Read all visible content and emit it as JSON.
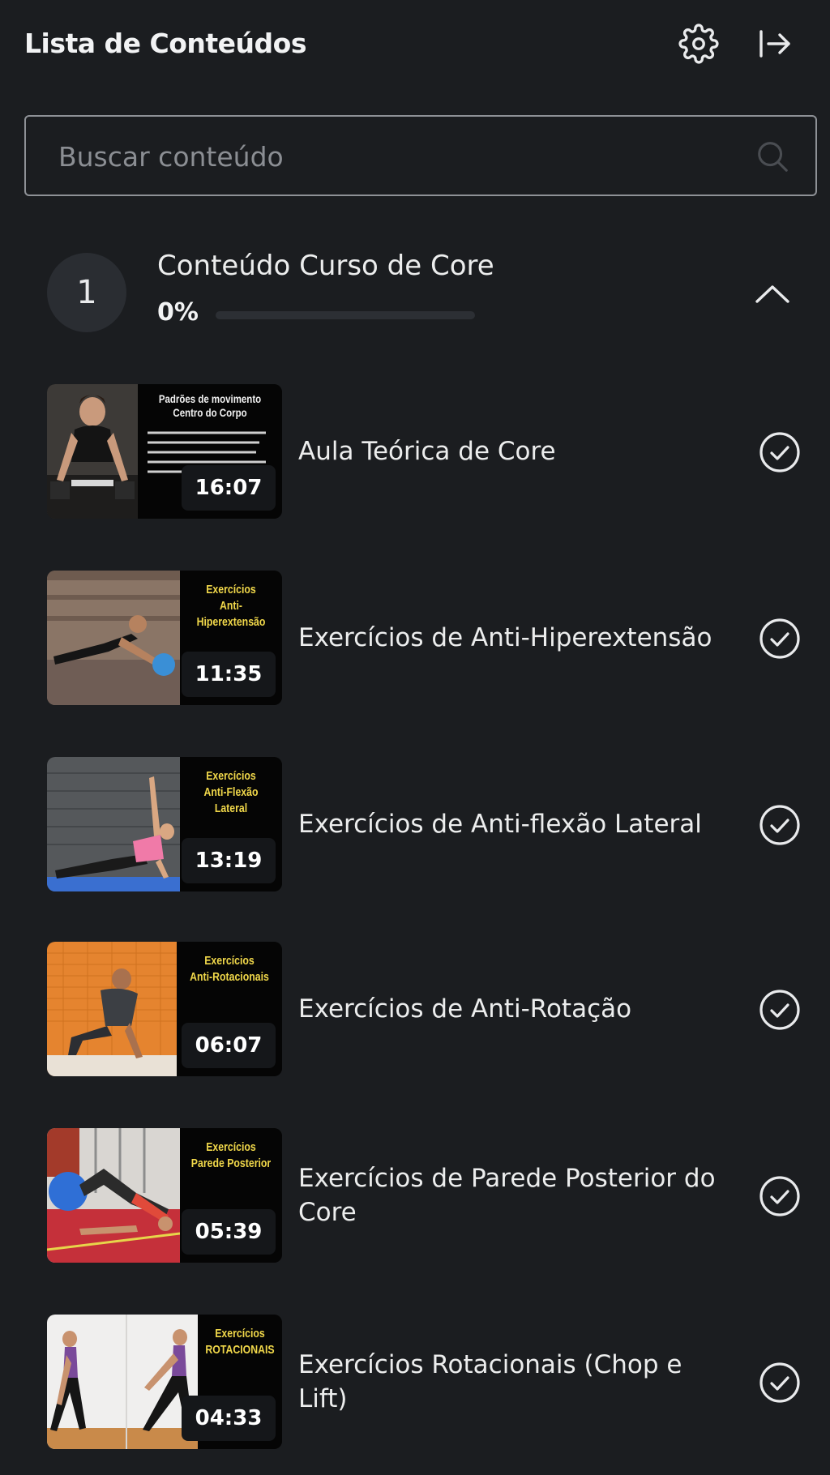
{
  "header": {
    "title": "Lista de Conteúdos",
    "settings_icon": "gear-icon",
    "exit_icon": "sidebar-exit-icon"
  },
  "search": {
    "placeholder": "Buscar conteúdo",
    "value": "",
    "icon": "search-icon"
  },
  "module": {
    "number": "1",
    "title": "Conteúdo Curso de Core",
    "progress_label": "0%",
    "progress": 0,
    "expanded": true
  },
  "colors": {
    "background": "#1b1d20",
    "caption_yellow": "#f1d84a",
    "text": "#eceded"
  },
  "lessons": [
    {
      "title": "Aula Teórica de Core",
      "duration": "16:07",
      "completed": true,
      "thumb_caption": [
        "Padrões de movimento",
        "Centro do Corpo"
      ]
    },
    {
      "title": "Exercícios de Anti-Hiperextensão",
      "duration": "11:35",
      "completed": true,
      "thumb_caption": [
        "Exercícios",
        "Anti-Hiperextensão"
      ]
    },
    {
      "title": "Exercícios de Anti-flexão Lateral",
      "duration": "13:19",
      "completed": true,
      "thumb_caption": [
        "Exercícios",
        "Anti-Flexão Lateral"
      ]
    },
    {
      "title": "Exercícios de Anti-Rotação",
      "duration": "06:07",
      "completed": true,
      "thumb_caption": [
        "Exercícios",
        "Anti-Rotacionais"
      ]
    },
    {
      "title": "Exercícios de Parede Posterior do Core",
      "duration": "05:39",
      "completed": true,
      "thumb_caption": [
        "Exercícios",
        "Parede Posterior"
      ]
    },
    {
      "title": "Exercícios Rotacionais (Chop e Lift)",
      "duration": "04:33",
      "completed": true,
      "thumb_caption": [
        "Exercícios",
        "ROTACIONAIS"
      ]
    }
  ]
}
